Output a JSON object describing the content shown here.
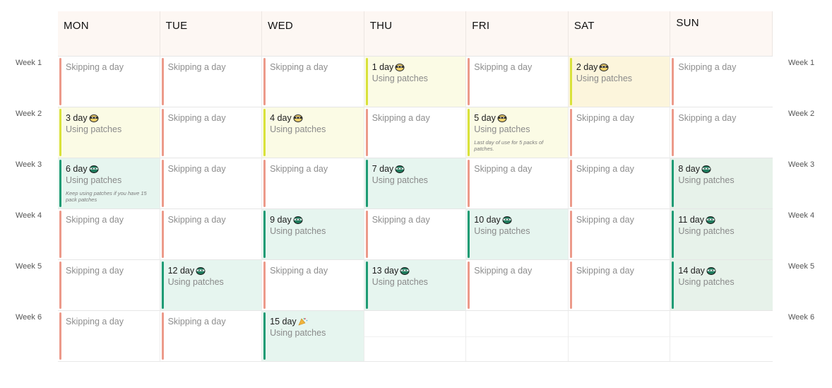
{
  "days": [
    "MON",
    "TUE",
    "WED",
    "THU",
    "FRI",
    "SAT",
    "SUN"
  ],
  "weeks": [
    "Week 1",
    "Week 2",
    "Week 3",
    "Week 4",
    "Week 5",
    "Week 6"
  ],
  "skip_label": "Skipping a day",
  "using_label": "Using patches",
  "colors": {
    "skip_bar": "#ec9a8a",
    "yellow_bar": "#d9e23a",
    "green_bar": "#1e9b74",
    "header_bg": "#fdf7f3"
  },
  "entries": {
    "w1_thu": {
      "title": "1 day",
      "icon": "ninja-face-icon"
    },
    "w1_sat": {
      "title": "2 day",
      "icon": "ninja-face-icon"
    },
    "w2_mon": {
      "title": "3 day",
      "icon": "ninja-face-icon"
    },
    "w2_wed": {
      "title": "4 day",
      "icon": "ninja-face-icon"
    },
    "w2_fri": {
      "title": "5 day",
      "icon": "ninja-face-icon",
      "note": "Last day of use for 5 packs of patches."
    },
    "w3_mon": {
      "title": "6 day",
      "icon": "ninja-green-icon",
      "note": "Keep using patches if you have 15 pack patches"
    },
    "w3_thu": {
      "title": "7 day",
      "icon": "ninja-green-icon"
    },
    "w3_sun": {
      "title": "8 day",
      "icon": "ninja-green-icon"
    },
    "w4_wed": {
      "title": "9 day",
      "icon": "ninja-green-icon"
    },
    "w4_fri": {
      "title": "10 day",
      "icon": "ninja-green-icon"
    },
    "w4_sun": {
      "title": "11 day",
      "icon": "ninja-green-icon"
    },
    "w5_tue": {
      "title": "12 day",
      "icon": "ninja-green-icon"
    },
    "w5_thu": {
      "title": "13 day",
      "icon": "ninja-green-icon"
    },
    "w5_sun": {
      "title": "14 day",
      "icon": "ninja-green-icon"
    },
    "w6_wed": {
      "title": "15 day",
      "icon": "party-popper-icon"
    }
  }
}
